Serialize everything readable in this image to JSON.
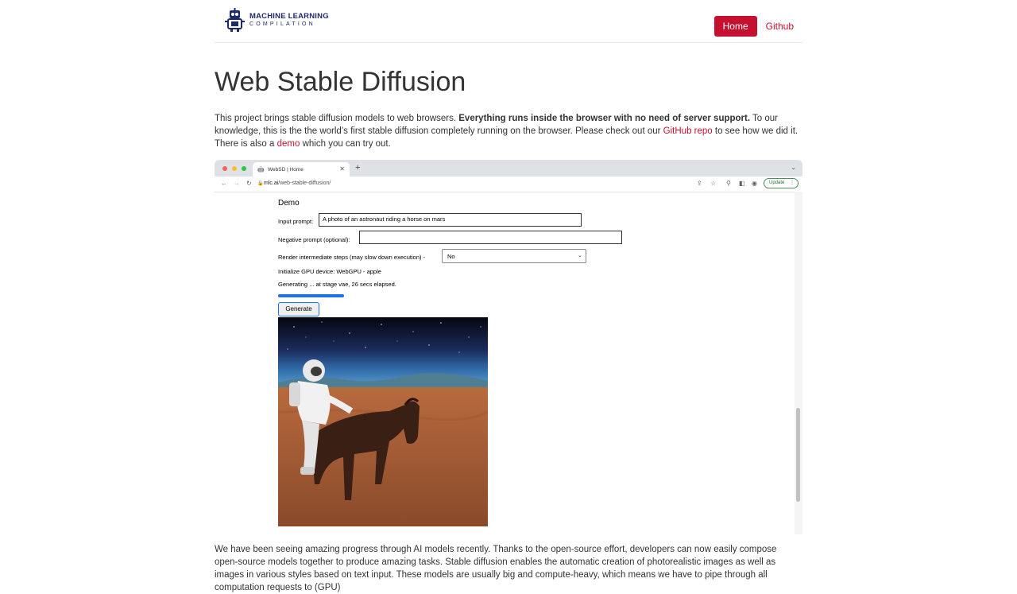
{
  "nav": {
    "logo_line1": "MACHINE LEARNING",
    "logo_line2": "COMPILATION",
    "home": "Home",
    "github": "Github"
  },
  "page_title": "Web Stable Diffusion",
  "intro": {
    "p1": "This project brings stable diffusion models to web browsers. ",
    "p1_bold": "Everything runs inside the browser with no need of server support.",
    "p2": " To our knowledge, this is the the world’s first stable diffusion completely running on the browser. Please check out our ",
    "link_repo": "GitHub repo",
    "p3": " to see how we did it. There is also a ",
    "link_demo": "demo",
    "p4": " which you can try out."
  },
  "screenshot": {
    "tab_title": "WebSD | Home",
    "url_host": "mlc.ai",
    "url_path": "/web-stable-diffusion/",
    "update_label": "Update",
    "demo_heading": "Demo",
    "input_label": "Input prompt:",
    "input_value": "A photo of an astronaut riding a horse on mars",
    "negative_label": "Negative prompt (optional):",
    "negative_value": "",
    "render_label": "Render intermediate steps (may slow down execution) -",
    "render_value": "No",
    "gpu_status": "Initialize GPU device: WebGPU - apple",
    "gen_status": "Generating ... at stage vae, 26 secs elapsed.",
    "progress": 0.3,
    "generate_label": "Generate"
  },
  "outro": {
    "text": "We have been seeing amazing progress through AI models recently. Thanks to the open-source effort, developers can now easily compose open-source models together to produce amazing tasks. Stable diffusion enables the automatic creation of photorealistic images as well as images in various styles based on text input. These models are usually big and compute-heavy, which means we have to pipe through all computation requests to (GPU)"
  },
  "colors": {
    "brand_red": "#c5102f",
    "logo_navy": "#1e2a6b",
    "progress_blue": "#1a73e8"
  },
  "icons": {
    "tab_favicon": "robot-favicon-icon",
    "back": "arrow-left-icon",
    "forward": "arrow-right-icon",
    "reload": "reload-icon",
    "lock": "lock-icon",
    "share": "share-icon",
    "star": "star-icon",
    "extensions": "puzzle-icon",
    "sidebar": "sidebar-icon",
    "profile": "profile-icon"
  }
}
